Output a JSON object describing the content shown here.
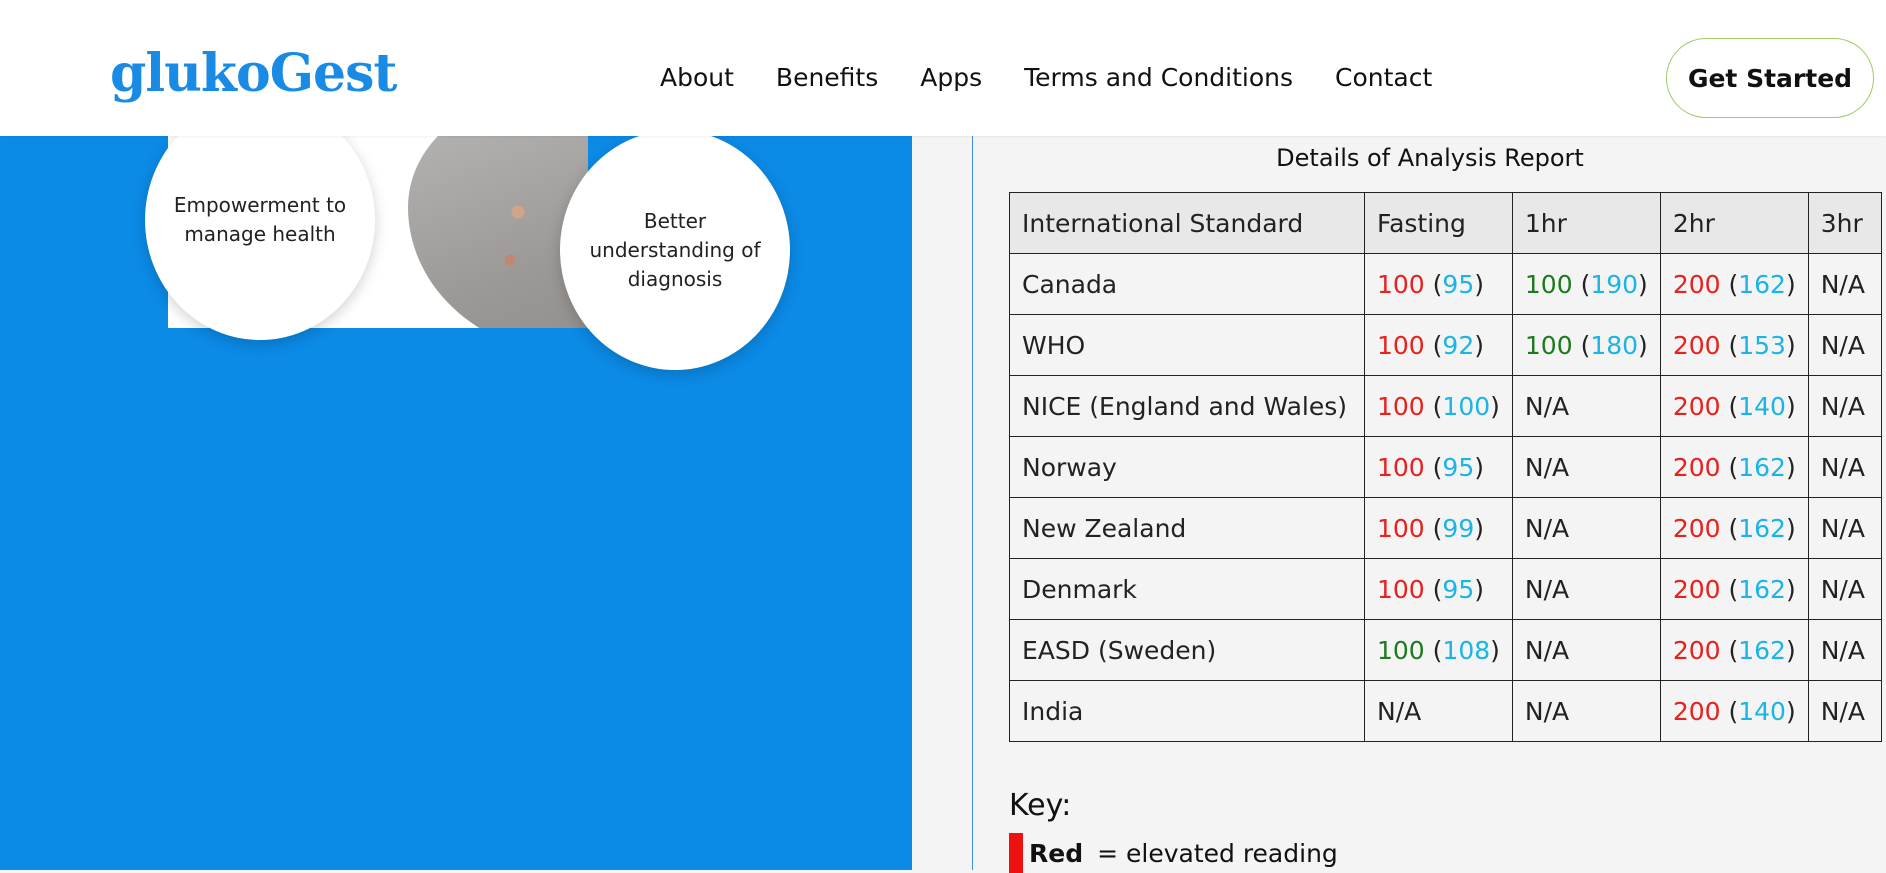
{
  "header": {
    "logo": "glukoGest",
    "nav": [
      "About",
      "Benefits",
      "Apps",
      "Terms and Conditions",
      "Contact"
    ],
    "cta": "Get Started"
  },
  "hero": {
    "circle1": "Empowerment to manage health",
    "circle2": "Better understanding of diagnosis"
  },
  "report": {
    "title": "Details of Analysis Report",
    "headers": [
      "International Standard",
      "Fasting",
      "1hr",
      "2hr",
      "3hr"
    ],
    "rows": [
      {
        "name": "Canada",
        "fasting": {
          "v": "100",
          "vc": "red",
          "r": "95"
        },
        "h1": {
          "v": "100",
          "vc": "green",
          "r": "190"
        },
        "h2": {
          "v": "200",
          "vc": "red",
          "r": "162"
        },
        "h3": "N/A"
      },
      {
        "name": "WHO",
        "fasting": {
          "v": "100",
          "vc": "red",
          "r": "92"
        },
        "h1": {
          "v": "100",
          "vc": "green",
          "r": "180"
        },
        "h2": {
          "v": "200",
          "vc": "red",
          "r": "153"
        },
        "h3": "N/A"
      },
      {
        "name": "NICE (England and Wales)",
        "fasting": {
          "v": "100",
          "vc": "red",
          "r": "100"
        },
        "h1": "N/A",
        "h2": {
          "v": "200",
          "vc": "red",
          "r": "140"
        },
        "h3": "N/A"
      },
      {
        "name": "Norway",
        "fasting": {
          "v": "100",
          "vc": "red",
          "r": "95"
        },
        "h1": "N/A",
        "h2": {
          "v": "200",
          "vc": "red",
          "r": "162"
        },
        "h3": "N/A"
      },
      {
        "name": "New Zealand",
        "fasting": {
          "v": "100",
          "vc": "red",
          "r": "99"
        },
        "h1": "N/A",
        "h2": {
          "v": "200",
          "vc": "red",
          "r": "162"
        },
        "h3": "N/A"
      },
      {
        "name": "Denmark",
        "fasting": {
          "v": "100",
          "vc": "red",
          "r": "95"
        },
        "h1": "N/A",
        "h2": {
          "v": "200",
          "vc": "red",
          "r": "162"
        },
        "h3": "N/A"
      },
      {
        "name": "EASD (Sweden)",
        "fasting": {
          "v": "100",
          "vc": "green",
          "r": "108"
        },
        "h1": "N/A",
        "h2": {
          "v": "200",
          "vc": "red",
          "r": "162"
        },
        "h3": "N/A"
      },
      {
        "name": "India",
        "fasting": "N/A",
        "h1": "N/A",
        "h2": {
          "v": "200",
          "vc": "red",
          "r": "140"
        },
        "h3": "N/A"
      }
    ]
  },
  "key": {
    "title": "Key:",
    "items": [
      {
        "label": "Red",
        "desc": "= elevated reading",
        "color": "#ee1111"
      }
    ]
  },
  "colors": {
    "brand": "#1a8be5",
    "panel": "#0b8ae6",
    "red": "#e8201e",
    "green": "#1f7a1f",
    "cyan": "#1bb4e6"
  }
}
